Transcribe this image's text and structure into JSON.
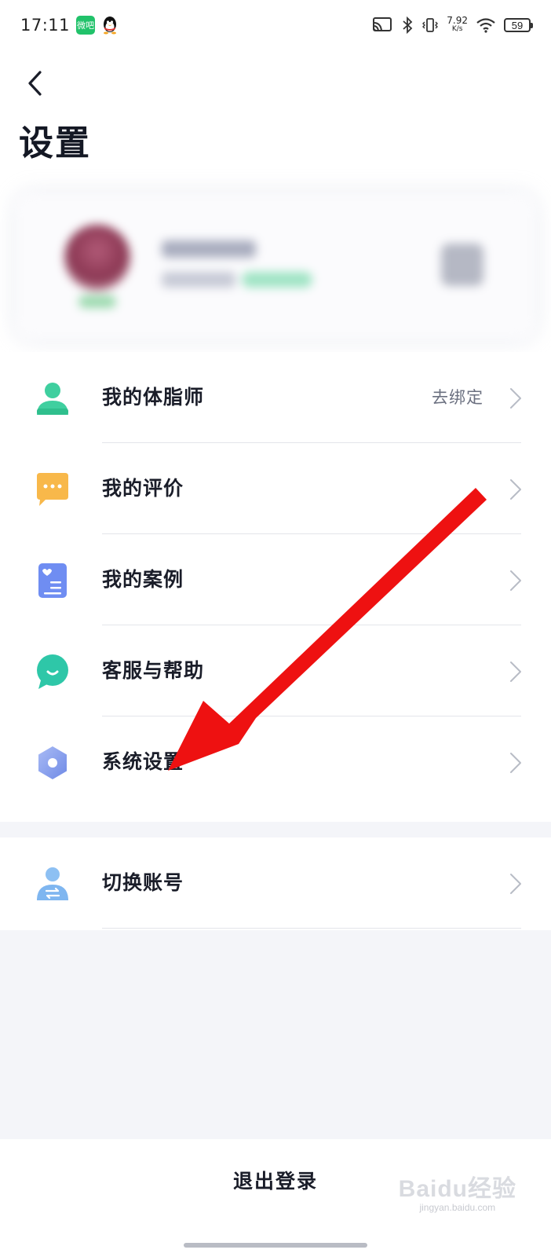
{
  "status_bar": {
    "time": "17:11",
    "app_badge": "微吧",
    "net_speed_value": "7.92",
    "net_speed_unit": "K/s",
    "battery": "59"
  },
  "header": {
    "title": "设置"
  },
  "menu": {
    "items": [
      {
        "label": "我的体脂师",
        "trailing": "去绑定",
        "icon": "person-icon",
        "color": "#3fcf9f"
      },
      {
        "label": "我的评价",
        "trailing": "",
        "icon": "chat-bubble-icon",
        "color": "#f8b84a"
      },
      {
        "label": "我的案例",
        "trailing": "",
        "icon": "document-icon",
        "color": "#6f8df2"
      },
      {
        "label": "客服与帮助",
        "trailing": "",
        "icon": "service-icon",
        "color": "#2ec7a8"
      },
      {
        "label": "系统设置",
        "trailing": "",
        "icon": "hexagon-settings-icon",
        "color": "#8ea4ee"
      }
    ],
    "secondary": [
      {
        "label": "切换账号",
        "trailing": "",
        "icon": "switch-account-icon",
        "color": "#7fb6f0"
      }
    ]
  },
  "logout": {
    "label": "退出登录"
  },
  "watermark": {
    "brand": "Baidu经验",
    "url": "jingyan.baidu.com"
  }
}
